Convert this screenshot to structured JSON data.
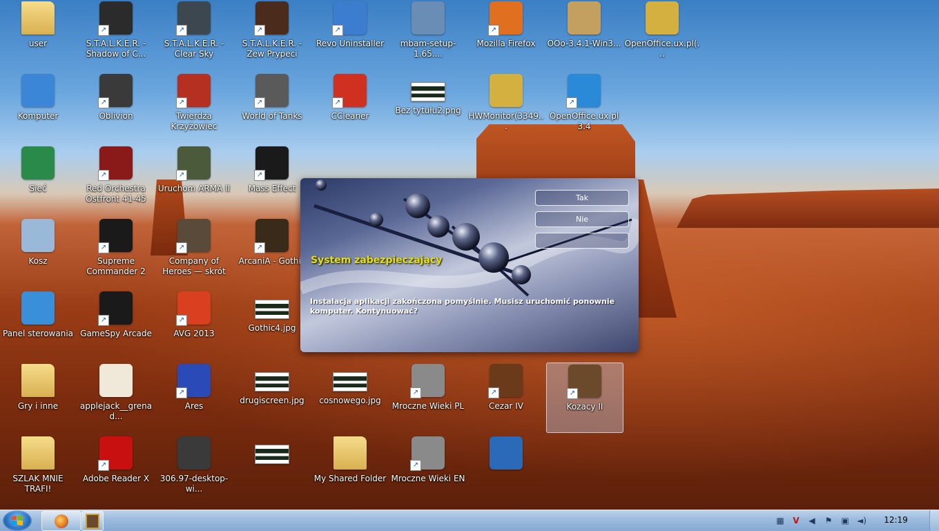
{
  "desktop": {
    "icons": [
      {
        "label": "user",
        "glyph": "folder-user",
        "color": "#e8c66a",
        "shortcut": false
      },
      {
        "label": "S.T.A.L.K.E.R. - Shadow of C...",
        "glyph": "radiation",
        "color": "#2b2b2b",
        "shortcut": true
      },
      {
        "label": "S.T.A.L.K.E.R. - Clear Sky",
        "glyph": "radiation",
        "color": "#3d4750",
        "shortcut": true
      },
      {
        "label": "S.T.A.L.K.E.R. - Zew Prypeci",
        "glyph": "radiation",
        "color": "#4b2b1c",
        "shortcut": true
      },
      {
        "label": "Revo Uninstaller",
        "glyph": "installer",
        "color": "#3d7dd0",
        "shortcut": true
      },
      {
        "label": "mbam-setup-1.65....",
        "glyph": "setup",
        "color": "#6a8db6",
        "shortcut": false
      },
      {
        "label": "Mozilla Firefox",
        "glyph": "firefox",
        "color": "#e07020",
        "shortcut": true
      },
      {
        "label": "OOo-3.4.1-Win3...",
        "glyph": "setup-box",
        "color": "#c4a060",
        "shortcut": false
      },
      {
        "label": "OpenOffice.ux.pl(...",
        "glyph": "crown",
        "color": "#d4b040",
        "shortcut": false
      },
      {
        "label": "Komputer",
        "glyph": "computer",
        "color": "#3b86d6",
        "shortcut": false
      },
      {
        "label": "Oblivion",
        "glyph": "oblivion",
        "color": "#3a3a3a",
        "shortcut": true
      },
      {
        "label": "Twierdza Krzyżowiec",
        "glyph": "shield-cross",
        "color": "#b53020",
        "shortcut": true
      },
      {
        "label": "World of Tanks",
        "glyph": "tank",
        "color": "#5a5a5a",
        "shortcut": true
      },
      {
        "label": "CCleaner",
        "glyph": "ccleaner",
        "color": "#d03020",
        "shortcut": true
      },
      {
        "label": "Bez tytułu2.png",
        "glyph": "image-file",
        "color": "#e8e8e8",
        "shortcut": false
      },
      {
        "label": "HWMonitor(3349...",
        "glyph": "crown",
        "color": "#d4b040",
        "shortcut": false
      },
      {
        "label": "OpenOffice.ux.pl 3.4",
        "glyph": "openoffice",
        "color": "#2b8ad8",
        "shortcut": true
      },
      {
        "label": "Sieć",
        "glyph": "network",
        "color": "#2a8a4a",
        "shortcut": false
      },
      {
        "label": "Red Orchestra Ostfront 41-45",
        "glyph": "red-orchestra",
        "color": "#8a1a1a",
        "shortcut": true
      },
      {
        "label": "Uruchom ARMA II",
        "glyph": "soldier",
        "color": "#4a5a3a",
        "shortcut": true
      },
      {
        "label": "Mass Effect",
        "glyph": "n7",
        "color": "#1a1a1a",
        "shortcut": true
      },
      {
        "label": "Company of Heroes — skrót",
        "glyph": "soldiers",
        "color": "#5a4a3a",
        "shortcut": true
      },
      {
        "label": "ArcaniA - Gothic",
        "glyph": "arcania",
        "color": "#3a2a1a",
        "shortcut": true
      },
      {
        "label": "Kosz",
        "glyph": "recycle-bin",
        "color": "#9ab8d8",
        "shortcut": false
      },
      {
        "label": "Supreme Commander 2",
        "glyph": "sc2",
        "color": "#1a1a1a",
        "shortcut": true
      },
      {
        "label": "Panel sterowania",
        "glyph": "control-panel",
        "color": "#3a90d8",
        "shortcut": false
      },
      {
        "label": "GameSpy Arcade",
        "glyph": "gamespy",
        "color": "#1a1a1a",
        "shortcut": true
      },
      {
        "label": "AVG 2013",
        "glyph": "avg",
        "color": "#d84020",
        "shortcut": true
      },
      {
        "label": "Gothic4.jpg",
        "glyph": "image-file",
        "color": "#e8e8e8",
        "shortcut": false
      },
      {
        "label": "Gry i inne",
        "glyph": "folder",
        "color": "#e8c66a",
        "shortcut": false
      },
      {
        "label": "applejack__grenad...",
        "glyph": "pony-image",
        "color": "#f0e8d8",
        "shortcut": false
      },
      {
        "label": "Ares",
        "glyph": "ares",
        "color": "#2a4ab8",
        "shortcut": true
      },
      {
        "label": "drugiscreen.jpg",
        "glyph": "image-file",
        "color": "#e8e8e8",
        "shortcut": false
      },
      {
        "label": "cosnowego.jpg",
        "glyph": "image-file",
        "color": "#e8e8e8",
        "shortcut": false
      },
      {
        "label": "Mroczne Wieki PL",
        "glyph": "medieval",
        "color": "#8a8a8a",
        "shortcut": true
      },
      {
        "label": "Cezar IV",
        "glyph": "caesar",
        "color": "#6a3a1a",
        "shortcut": true
      },
      {
        "label": "Kozacy II",
        "glyph": "napoleon",
        "color": "#6a4a2a",
        "shortcut": true
      },
      {
        "label": "SZLAK MNIE TRAFI!",
        "glyph": "folder",
        "color": "#e8c66a",
        "shortcut": false
      },
      {
        "label": "Adobe Reader X",
        "glyph": "adobe",
        "color": "#c81010",
        "shortcut": true
      },
      {
        "label": "306.97-desktop-wi...",
        "glyph": "nvidia",
        "color": "#3a3a3a",
        "shortcut": false
      },
      {
        "label": "",
        "glyph": "image-file",
        "color": "#e8e8e8",
        "shortcut": false
      },
      {
        "label": "My Shared Folder",
        "glyph": "folder",
        "color": "#e8c66a",
        "shortcut": false
      },
      {
        "label": "Mroczne Wieki EN",
        "glyph": "medieval",
        "color": "#8a8a8a",
        "shortcut": true
      },
      {
        "label": "",
        "glyph": "document",
        "color": "#2a6ab8",
        "shortcut": false
      }
    ]
  },
  "dialog": {
    "title": "System zabezpieczający",
    "message": "Instalacja aplikacji zakończona pomyślnie. Musisz uruchomić ponownie komputer. Kontynuować?",
    "buttons": {
      "yes": "Tak",
      "no": "Nie",
      "third": ""
    }
  },
  "taskbar": {
    "clock": "12:19",
    "tasks": [
      {
        "name": "firefox-task",
        "glyph": "firefox",
        "color": "#e07020"
      },
      {
        "name": "kozacy-task",
        "glyph": "napoleon",
        "color": "#6a4a2a"
      }
    ],
    "tray": [
      "flag-icon",
      "antivirus-icon",
      "volume-icon",
      "action-center-icon",
      "network-icon",
      "speaker-icon"
    ]
  }
}
